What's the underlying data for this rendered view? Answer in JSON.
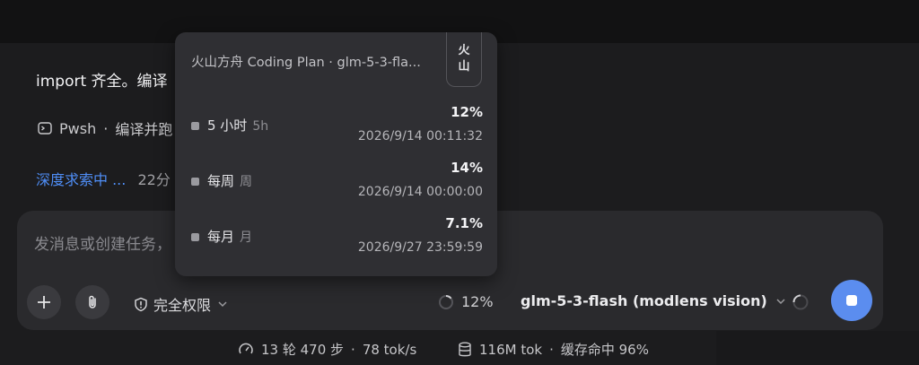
{
  "conversation": {
    "message_text": "import 齐全。编译",
    "tool": {
      "name": "Pwsh",
      "separator": "·",
      "summary": "编译并跑"
    },
    "search": {
      "link": "深度求索中 ...",
      "time": "22分"
    }
  },
  "composer": {
    "placeholder": "发消息或创建任务，",
    "permission_label": "完全权限",
    "usage_percent": "12%",
    "model_name": "glm-5-3-flash (modlens vision)"
  },
  "quota_popup": {
    "title": "火山方舟 Coding Plan · glm-5-3-fla...",
    "provider_badge": [
      "火",
      "山"
    ],
    "rows": [
      {
        "label": "5 小时",
        "sub": "5h",
        "percent": "12%",
        "reset": "2026/9/14 00:11:32"
      },
      {
        "label": "每周",
        "sub": "周",
        "percent": "14%",
        "reset": "2026/9/14 00:00:00"
      },
      {
        "label": "每月",
        "sub": "月",
        "percent": "7.1%",
        "reset": "2026/9/27 23:59:59"
      }
    ]
  },
  "status_bar": {
    "steps": "13 轮 470 步",
    "speed": "78 tok/s",
    "tokens": "116M tok",
    "cache": "缓存命中 96%",
    "separator": "·"
  },
  "colors": {
    "accent": "#5b8def",
    "link": "#4f8ef7",
    "panel": "#2a2a2d",
    "popup": "#2f2f33"
  },
  "icons": [
    "terminal-icon",
    "plus-icon",
    "paperclip-icon",
    "shield-icon",
    "chevron-down-icon",
    "progress-ring-icon",
    "spinner-icon",
    "stop-icon",
    "gauge-icon",
    "database-icon"
  ]
}
